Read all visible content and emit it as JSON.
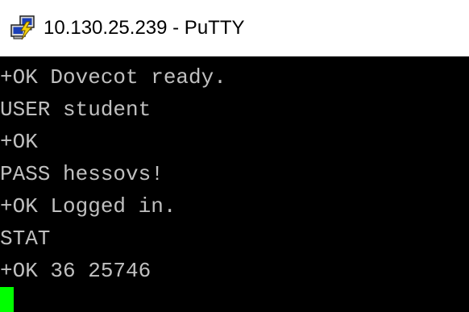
{
  "window": {
    "title": "10.130.25.239 - PuTTY",
    "icon": "putty-icon"
  },
  "terminal": {
    "lines": [
      "+OK Dovecot ready.",
      "USER student",
      "+OK",
      "PASS hessovs!",
      "+OK Logged in.",
      "STAT",
      "+OK 36 25746"
    ],
    "foreground": "#c0c0c0",
    "background": "#000000",
    "cursor_color": "#00ff00"
  }
}
